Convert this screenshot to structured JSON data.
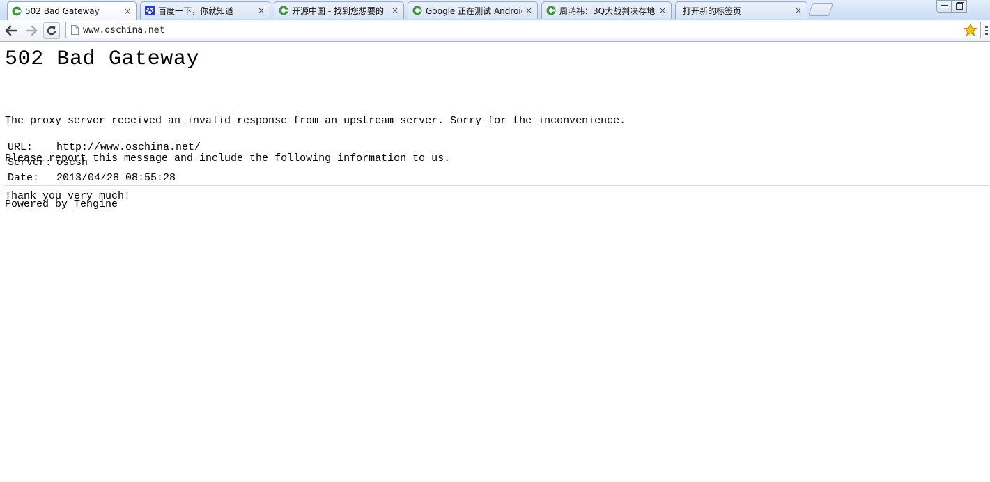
{
  "tabs": [
    {
      "title": "502 Bad Gateway",
      "icon": "chrome-icon",
      "active": true
    },
    {
      "title": "百度一下，你就知道",
      "icon": "baidu-paw-icon",
      "active": false
    },
    {
      "title": "开源中国 - 找到您想要的",
      "icon": "chrome-icon",
      "active": false
    },
    {
      "title": "Google 正在测试 Android",
      "icon": "chrome-icon",
      "active": false
    },
    {
      "title": "周鸿祎：3Q大战判决存地",
      "icon": "chrome-icon",
      "active": false
    },
    {
      "title": "打开新的标签页",
      "icon": "none",
      "active": false
    }
  ],
  "tab_close_glyph": "×",
  "toolbar": {
    "url": "www.oschina.net",
    "back_icon": "back-arrow-icon",
    "forward_icon": "forward-arrow-icon",
    "reload_icon": "reload-icon",
    "bookmark_icon": "star-icon"
  },
  "page": {
    "heading": "502 Bad Gateway",
    "message_lines": [
      "The proxy server received an invalid response from an upstream server. Sorry for the inconvenience.",
      "Please report this message and include the following information to us.",
      "Thank you very much!"
    ],
    "info": [
      {
        "label": "URL:",
        "value": "http://www.oschina.net/"
      },
      {
        "label": "Server:",
        "value": "oscsh"
      },
      {
        "label": "Date:",
        "value": "2013/04/28 08:55:28"
      }
    ],
    "footer": "Powered by Tengine"
  },
  "colors": {
    "tabstrip": "#c9dcf5",
    "chrome_icon_green": "#3b9a3f",
    "baidu_blue": "#2a3bd4",
    "star_yellow": "#f5c518"
  }
}
